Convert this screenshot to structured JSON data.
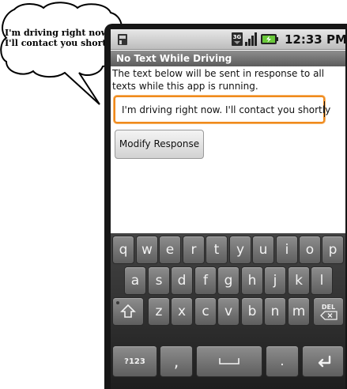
{
  "speech_bubble": {
    "line1": "I'm driving right now",
    "line2": "I'll contact you shortly"
  },
  "status_bar": {
    "network_label": "3G",
    "time": "12:33 PM"
  },
  "app": {
    "title": "No Text While Driving",
    "description": "The text below will be sent in response to all texts while this app is running.",
    "response_text": "I'm driving right now. I'll contact you shortly",
    "modify_button_label": "Modify Response"
  },
  "keyboard": {
    "row1": [
      "q",
      "w",
      "e",
      "r",
      "t",
      "y",
      "u",
      "i",
      "o",
      "p"
    ],
    "row2": [
      "a",
      "s",
      "d",
      "f",
      "g",
      "h",
      "j",
      "k",
      "l"
    ],
    "row3": [
      "z",
      "x",
      "c",
      "v",
      "b",
      "n",
      "m"
    ],
    "symbols_label": "?123",
    "comma_label": ",",
    "period_label": ".",
    "delete_label": "DEL"
  },
  "colors": {
    "input_focus": "#f08a1c",
    "title_bar": "#6e6e6e",
    "keyboard_bg": "#2b2b2b"
  }
}
